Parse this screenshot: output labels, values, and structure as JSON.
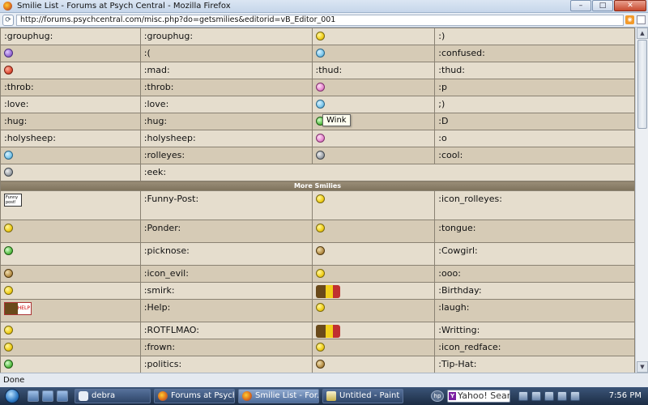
{
  "window": {
    "title": "Smilie List - Forums at Psych Central - Mozilla Firefox",
    "buttons": {
      "minimize": "–",
      "maximize": "□",
      "close": "✕"
    }
  },
  "address_bar": {
    "url": "http://forums.psychcentral.com/misc.php?do=getsmilies&editorid=vB_Editor_001"
  },
  "table": {
    "section1_rows": [
      {
        "left_icon": "grouphug-smilie",
        "left_code": ":grouphug:",
        "left_icon_color": "purple",
        "right_icon": "smile",
        "right_code": ":)",
        "right_icon_color": "yellow",
        "left_text_override": ":grouphug:"
      },
      {
        "left_icon": "frown",
        "left_code": ":(",
        "left_icon_color": "purple",
        "right_icon": "confused",
        "right_code": ":confused:",
        "right_icon_color": "blue"
      },
      {
        "left_icon": "mad",
        "left_code": ":mad:",
        "left_icon_color": "red",
        "right_icon": "thud",
        "right_code": ":thud:",
        "right_icon_color": "none"
      },
      {
        "left_icon": "throb",
        "left_code": ":throb:",
        "left_icon_color": "none",
        "right_icon": "tongue",
        "right_code": ":p",
        "right_icon_color": "pink"
      },
      {
        "left_icon": "love",
        "left_code": ":love:",
        "left_icon_color": "none",
        "right_icon": "wink",
        "right_code": ";)",
        "right_icon_color": "blue"
      },
      {
        "left_icon": "hug",
        "left_code": ":hug:",
        "left_icon_color": "none",
        "right_icon": "biggrin",
        "right_code": ":D",
        "right_icon_color": "green"
      },
      {
        "left_icon": "holysheep",
        "left_code": ":holysheep:",
        "left_icon_color": "none",
        "right_icon": "eek-o",
        "right_code": ":o",
        "right_icon_color": "pink"
      },
      {
        "left_icon": "rolleyes",
        "left_code": ":rolleyes:",
        "left_icon_color": "blue",
        "right_icon": "cool",
        "right_code": ":cool:",
        "right_icon_color": "gray"
      },
      {
        "left_icon": "eek",
        "left_code": ":eek:",
        "left_icon_color": "gray",
        "right_icon": "",
        "right_code": "",
        "right_icon_color": "none"
      }
    ],
    "col0_texts": [
      ":grouphug:",
      "",
      "",
      ":throb:",
      ":love:",
      ":hug:",
      ":holysheep:",
      "",
      ""
    ],
    "section_header": "More Smilies",
    "section2_rows": [
      {
        "left_code": ":Funny-Post:",
        "right_code": ":icon_rolleyes:"
      },
      {
        "left_code": ":Ponder:",
        "right_code": ":tongue:"
      },
      {
        "left_code": ":picknose:",
        "right_code": ":Cowgirl:"
      },
      {
        "left_code": ":icon_evil:",
        "right_code": ":ooo:"
      },
      {
        "left_code": ":smirk:",
        "right_code": ":Birthday:"
      },
      {
        "left_code": ":Help:",
        "right_code": ":laugh:"
      },
      {
        "left_code": ":ROTFLMAO:",
        "right_code": ":Writting:"
      },
      {
        "left_code": ":frown:",
        "right_code": ":icon_redface:"
      },
      {
        "left_code": ":politics:",
        "right_code": ":Tip-Hat:"
      }
    ],
    "funny_post_image_text": "Funny post!",
    "help_image_text": "HELP"
  },
  "tooltip": {
    "text": "Wink"
  },
  "status_bar": {
    "text": "Done"
  },
  "taskbar": {
    "tasks": [
      "debra",
      "Forums at Psych...",
      "Smilie List - For...",
      "Untitled - Paint"
    ],
    "search_placeholder": "Yahoo! Search",
    "hp_label": "hp",
    "clock": "7:56 PM"
  },
  "colors": {
    "row_light": "#e5ddcd",
    "row_dark": "#d6cbb6",
    "header": "#8a7e68",
    "titlebar": "#c6d6ea",
    "taskbar": "#1c2c44"
  }
}
